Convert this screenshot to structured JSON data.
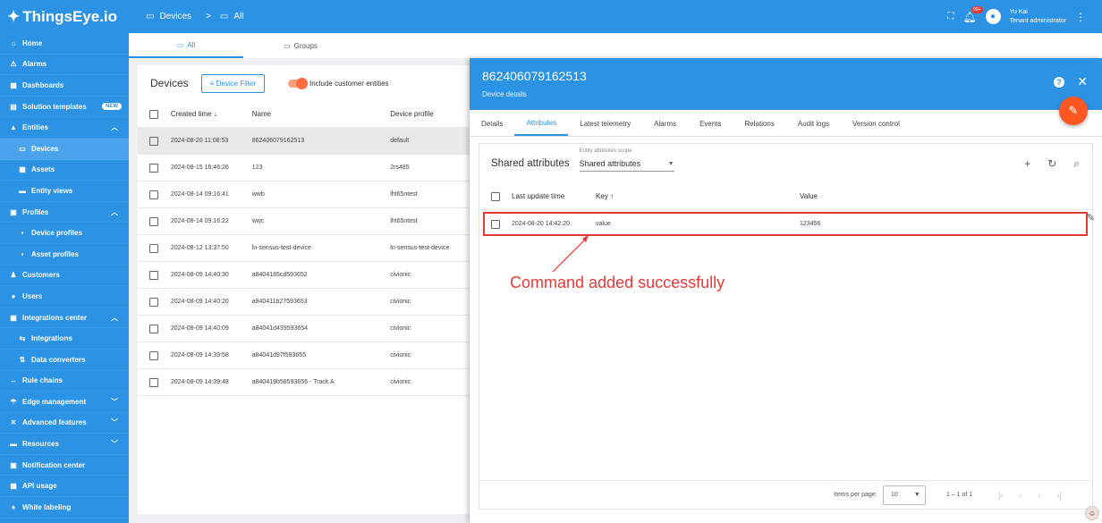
{
  "app": {
    "logo_text": "ThingsEye.io"
  },
  "sidebar": {
    "items": [
      {
        "label": "Home",
        "icon": "home-icon",
        "glyph": "⌂"
      },
      {
        "label": "Alarms",
        "icon": "alarm-icon",
        "glyph": "⚠"
      },
      {
        "label": "Dashboards",
        "icon": "dashboard-icon",
        "glyph": "▦"
      },
      {
        "label": "Solution templates",
        "icon": "template-icon",
        "glyph": "▤",
        "badge": "NEW"
      },
      {
        "label": "Entities",
        "icon": "entities-icon",
        "glyph": "▲",
        "chevron": "up"
      },
      {
        "label": "Devices",
        "icon": "devices-icon",
        "glyph": "▭",
        "sub": true,
        "active": true
      },
      {
        "label": "Assets",
        "icon": "assets-icon",
        "glyph": "▦",
        "sub": true
      },
      {
        "label": "Entity views",
        "icon": "entity-views-icon",
        "glyph": "▬",
        "sub": true
      },
      {
        "label": "Profiles",
        "icon": "profiles-icon",
        "glyph": "▣",
        "chevron": "up"
      },
      {
        "label": "Device profiles",
        "icon": "device-profiles-icon",
        "glyph": "▪",
        "sub": true
      },
      {
        "label": "Asset profiles",
        "icon": "asset-profiles-icon",
        "glyph": "▪",
        "sub": true
      },
      {
        "label": "Customers",
        "icon": "customers-icon",
        "glyph": "♟"
      },
      {
        "label": "Users",
        "icon": "users-icon",
        "glyph": "●"
      },
      {
        "label": "Integrations center",
        "icon": "integrations-center-icon",
        "glyph": "▦",
        "chevron": "up"
      },
      {
        "label": "Integrations",
        "icon": "integrations-icon",
        "glyph": "⇆",
        "sub": true
      },
      {
        "label": "Data converters",
        "icon": "data-converters-icon",
        "glyph": "⇅",
        "sub": true
      },
      {
        "label": "Rule chains",
        "icon": "rule-chains-icon",
        "glyph": "↔"
      },
      {
        "label": "Edge management",
        "icon": "edge-icon",
        "glyph": "☂",
        "chevron": "down"
      },
      {
        "label": "Advanced features",
        "icon": "advanced-icon",
        "glyph": "✕",
        "chevron": "down"
      },
      {
        "label": "Resources",
        "icon": "resources-icon",
        "glyph": "▬",
        "chevron": "down"
      },
      {
        "label": "Notification center",
        "icon": "notification-icon",
        "glyph": "▣"
      },
      {
        "label": "API usage",
        "icon": "api-icon",
        "glyph": "▦"
      },
      {
        "label": "White labeling",
        "icon": "white-label-icon",
        "glyph": "♦"
      }
    ]
  },
  "topbar": {
    "crumb1": "Devices",
    "sep": ">",
    "crumb2": "All",
    "notif_count": "99+",
    "user_name": "Yu Kai",
    "user_role": "Tenant administrator"
  },
  "tabs": {
    "all": "All",
    "groups": "Groups"
  },
  "devices": {
    "title": "Devices",
    "filter_label": "Device Filter",
    "include_label": "Include customer entities",
    "columns": {
      "created": "Created time ↓",
      "name": "Name",
      "profile": "Device profile"
    },
    "rows": [
      {
        "created": "2024-08-20 11:08:53",
        "name": "862406079162513",
        "profile": "default",
        "selected": true
      },
      {
        "created": "2024-08-15 16:46:26",
        "name": "123",
        "profile": "2rs485"
      },
      {
        "created": "2024-08-14 09:16:41",
        "name": "wwb",
        "profile": "lht65ntest"
      },
      {
        "created": "2024-08-14 09:16:22",
        "name": "wwc",
        "profile": "lht65ntest"
      },
      {
        "created": "2024-08-12 13:37:50",
        "name": "ln-sensus-test-device",
        "profile": "ln-sensus-test-device"
      },
      {
        "created": "2024-08-09 14:40:30",
        "name": "a8404185cd593652",
        "profile": "civionic"
      },
      {
        "created": "2024-08-09 14:40:20",
        "name": "a840411b27593653",
        "profile": "civionic"
      },
      {
        "created": "2024-08-09 14:40:09",
        "name": "a84041d439593654",
        "profile": "civionic"
      },
      {
        "created": "2024-08-09 14:39:58",
        "name": "a84041d97f593655",
        "profile": "civionic"
      },
      {
        "created": "2024-08-09 14:39:48",
        "name": "a840419b58593656 - Track A",
        "profile": "civionic"
      }
    ]
  },
  "details": {
    "title": "862406079162513",
    "subtitle": "Device details",
    "tabs": [
      "Details",
      "Attributes",
      "Latest telemetry",
      "Alarms",
      "Events",
      "Relations",
      "Audit logs",
      "Version control"
    ],
    "active_tab": 1,
    "attributes": {
      "heading": "Shared attributes",
      "scope_label": "Entity attributes scope",
      "scope_value": "Shared attributes",
      "columns": {
        "time": "Last update time",
        "key": "Key ↑",
        "value": "Value"
      },
      "rows": [
        {
          "time": "2024-08-20 14:42:20",
          "key": "value",
          "value": "123456"
        }
      ],
      "annotation": "Command added successfully",
      "footer": {
        "items_per_page": "Items per page:",
        "page_size": "10",
        "range": "1 – 1 of 1"
      }
    }
  },
  "colors": {
    "primary": "#2b92e4",
    "accent": "#ff5722",
    "highlight": "#e53935"
  }
}
